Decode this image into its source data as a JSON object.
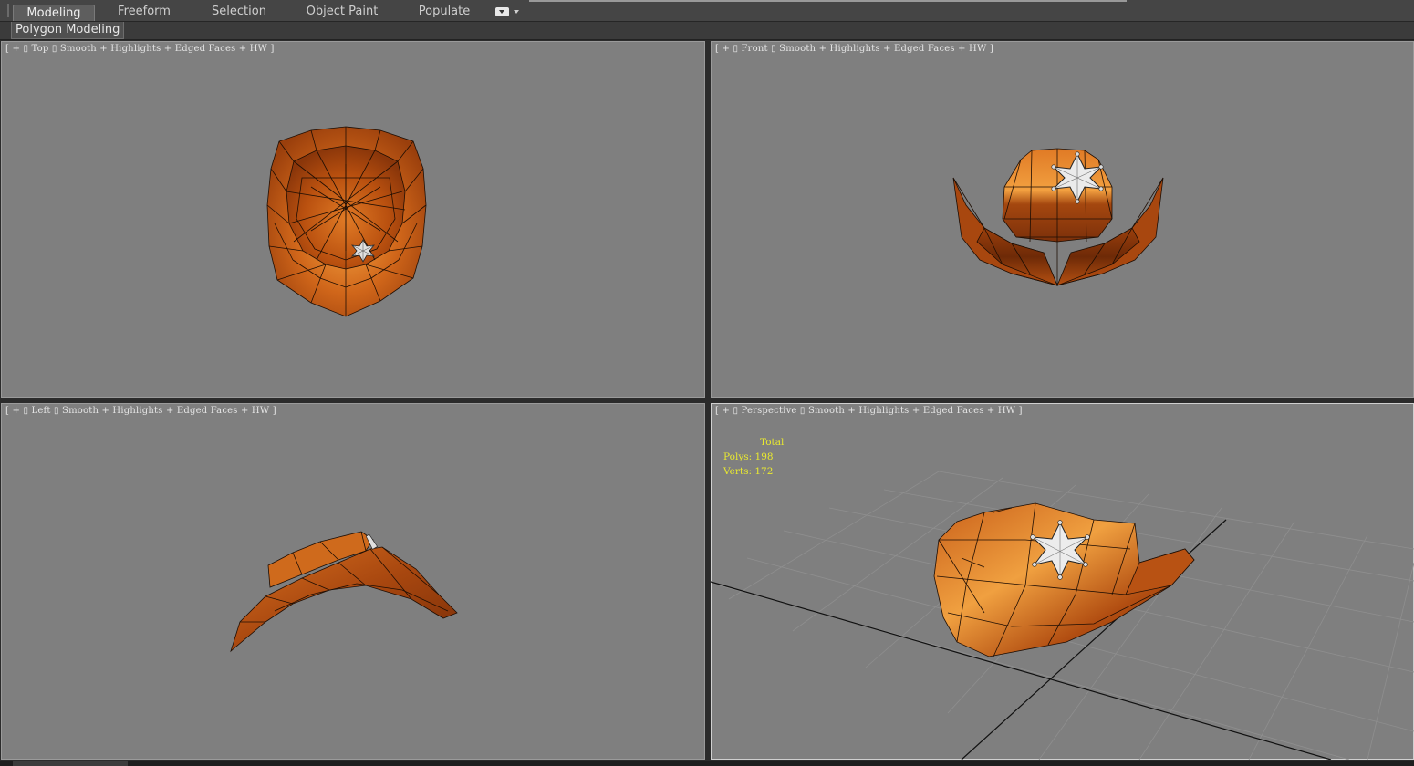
{
  "ribbon_tabs": [
    {
      "label": "Modeling",
      "active": true
    },
    {
      "label": "Freeform",
      "active": false
    },
    {
      "label": "Selection",
      "active": false
    },
    {
      "label": "Object Paint",
      "active": false
    },
    {
      "label": "Populate",
      "active": false
    }
  ],
  "ribbon_panel_label": "Polygon Modeling",
  "viewports": {
    "top": "[ + ▯ Top ▯ Smooth + Highlights + Edged Faces + HW ]",
    "front": "[ + ▯ Front ▯ Smooth + Highlights + Edged Faces + HW ]",
    "left": "[ + ▯ Left ▯ Smooth + Highlights + Edged Faces + HW ]",
    "perspective": "[ + ▯ Perspective ▯ Smooth + Highlights + Edged Faces + HW ]"
  },
  "stats": {
    "title": "Total",
    "polys": "Polys: 198",
    "verts": "Verts: 172"
  },
  "colors": {
    "viewport_bg": "#7f7f7f",
    "hat_orange": "#c65a12",
    "hat_highlight": "#f0a040",
    "stats_text": "#e8e830"
  },
  "icons": [
    "ribbon-dropdown-icon",
    "sheriff-star-badge-icon"
  ]
}
